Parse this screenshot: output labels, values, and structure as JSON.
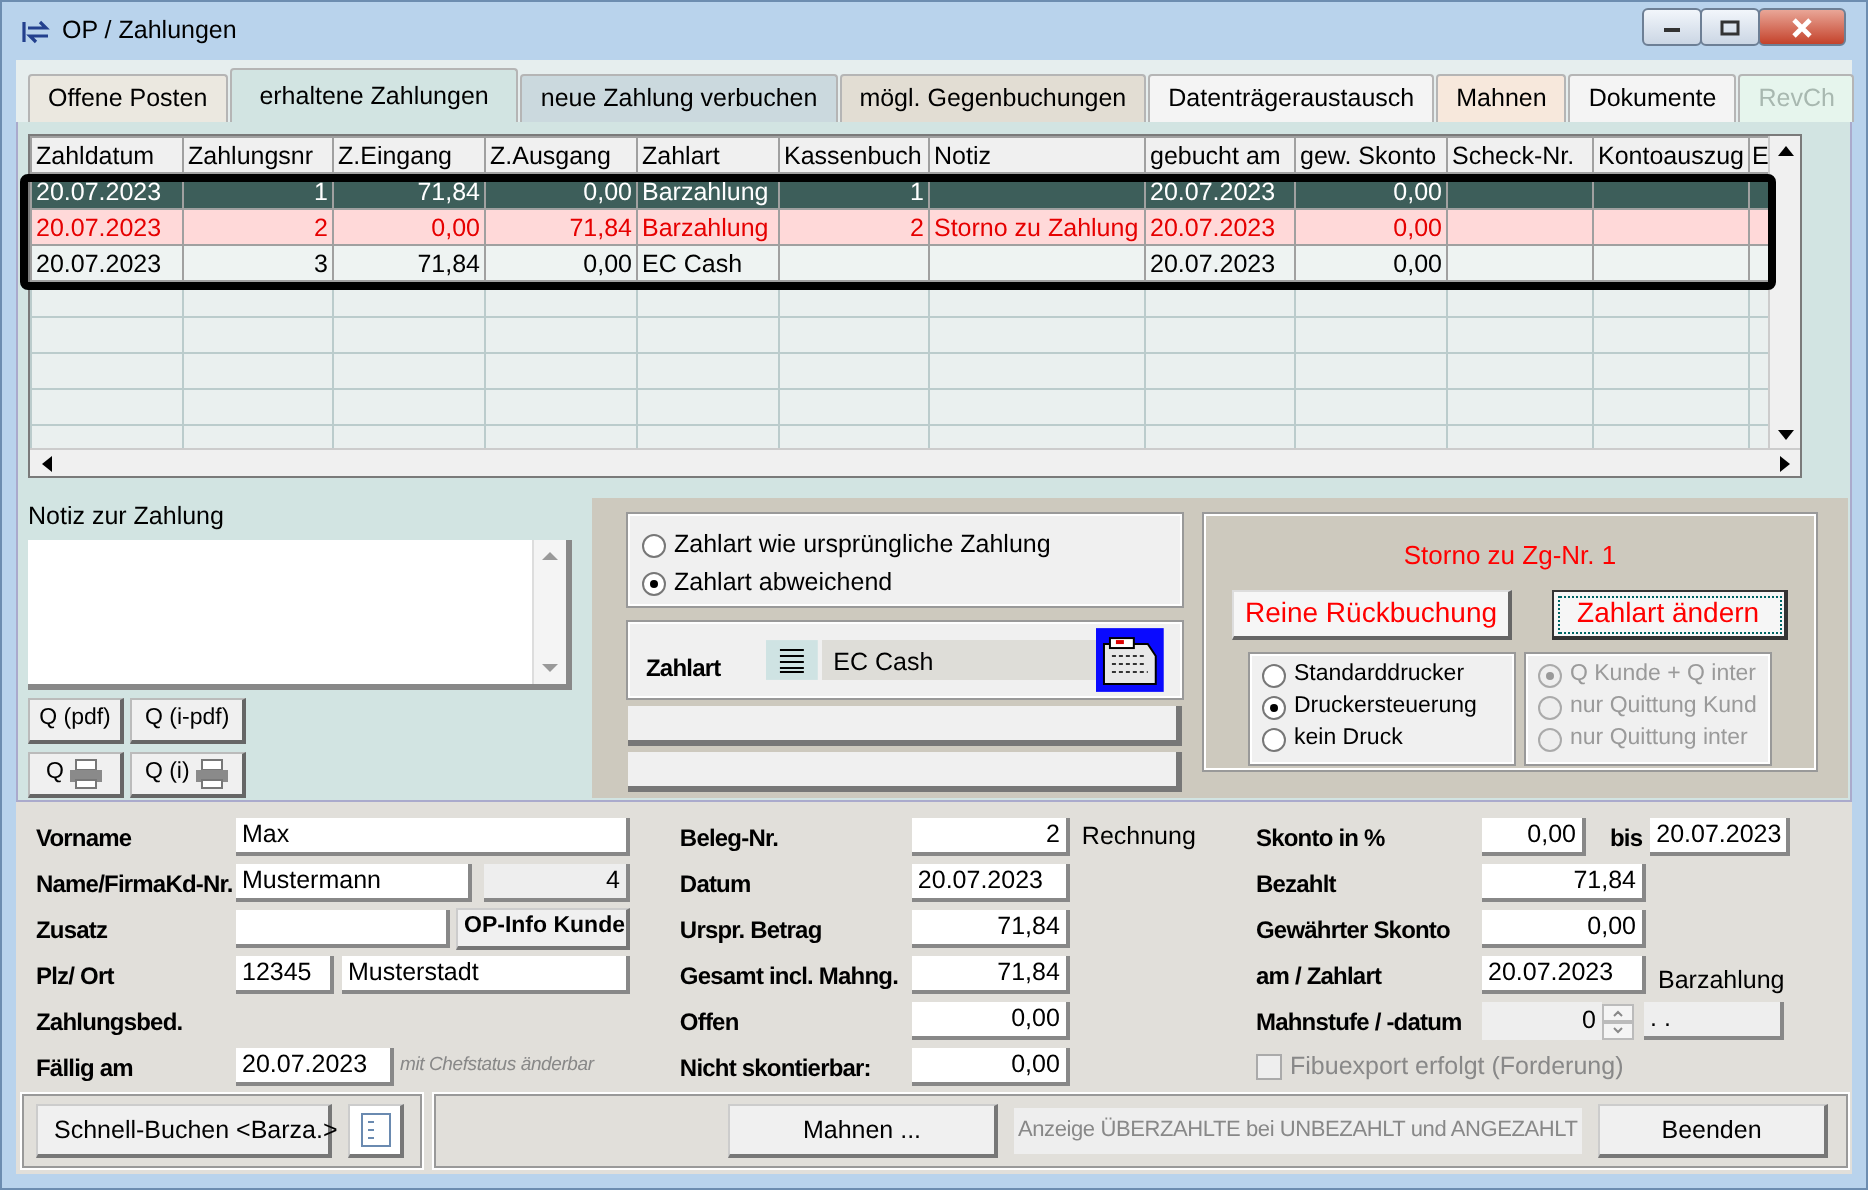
{
  "window": {
    "title": "OP / Zahlungen"
  },
  "tabs": [
    {
      "label": "Offene Posten",
      "selected": false,
      "disabled": false,
      "color": "#ebe8e0"
    },
    {
      "label": "erhaltene Zahlungen",
      "selected": true,
      "disabled": false,
      "color": "#d2e4e2"
    },
    {
      "label": "neue Zahlung verbuchen",
      "selected": false,
      "disabled": false,
      "color": "#cbd9de"
    },
    {
      "label": "mögl. Gegenbuchungen",
      "selected": false,
      "disabled": false,
      "color": "#e2ddd3"
    },
    {
      "label": "Datenträgeraustausch",
      "selected": false,
      "disabled": false,
      "color": "#f4f4f4"
    },
    {
      "label": "Mahnen",
      "selected": false,
      "disabled": false,
      "color": "#f7e8dc"
    },
    {
      "label": "Dokumente",
      "selected": false,
      "disabled": false,
      "color": "#f4f4f4"
    },
    {
      "label": "RevCh",
      "selected": false,
      "disabled": true,
      "color": "#e6f5ed"
    }
  ],
  "table": {
    "columns": [
      "Zahldatum",
      "Zahlungsnr",
      "Z.Eingang",
      "Z.Ausgang",
      "Zahlart",
      "Kassenbuch",
      "Notiz",
      "gebucht am",
      "gew. Skonto",
      "Scheck-Nr.",
      "Kontoauszug",
      "E"
    ],
    "rows": [
      {
        "selected": true,
        "kind": "payment",
        "cells": [
          "20.07.2023",
          "1",
          "71,84",
          "0,00",
          "Barzahlung",
          "1",
          "",
          "20.07.2023",
          "0,00",
          "",
          "",
          ""
        ]
      },
      {
        "selected": false,
        "kind": "reversal",
        "cells": [
          "20.07.2023",
          "2",
          "0,00",
          "71,84",
          "Barzahlung",
          "2",
          "Storno zu Zahlung",
          "20.07.2023",
          "0,00",
          "",
          "",
          ""
        ]
      },
      {
        "selected": false,
        "kind": "payment",
        "cells": [
          "20.07.2023",
          "3",
          "71,84",
          "0,00",
          "EC Cash",
          "",
          "",
          "20.07.2023",
          "0,00",
          "",
          "",
          ""
        ]
      }
    ]
  },
  "note": {
    "label": "Notiz zur Zahlung",
    "buttons": [
      {
        "label": "Q (pdf)",
        "kind": "text"
      },
      {
        "label": "Q (i-pdf)",
        "kind": "text"
      },
      {
        "label": "Q",
        "kind": "printer"
      },
      {
        "label": "Q (i)",
        "kind": "printer"
      }
    ]
  },
  "payment_type_options": [
    {
      "label": "Zahlart wie ursprüngliche Zahlung",
      "selected": false
    },
    {
      "label": "Zahlart abweichend",
      "selected": true
    }
  ],
  "payment_type": {
    "label": "Zahlart",
    "value": "EC Cash"
  },
  "reversal": {
    "title": "Storno zu Zg-Nr. 1",
    "buttons": [
      "Reine Rückbuchung",
      "Zahlart ändern"
    ],
    "printer_options": [
      {
        "label": "Standarddrucker",
        "selected": false
      },
      {
        "label": "Druckersteuerung",
        "selected": true
      },
      {
        "label": "kein Druck",
        "selected": false
      }
    ],
    "receipt_options": [
      {
        "label": "Q Kunde + Q inter",
        "selected": true,
        "disabled": true
      },
      {
        "label": "nur Quittung Kund",
        "selected": false,
        "disabled": true
      },
      {
        "label": "nur Quittung inter",
        "selected": false,
        "disabled": true
      }
    ]
  },
  "customer": {
    "first_name": {
      "label": "Vorname",
      "value": "Max"
    },
    "name": {
      "label": "Name/Firma",
      "value": "Mustermann"
    },
    "customer_no": {
      "label": "Kd-Nr.",
      "value": "4"
    },
    "addition": {
      "label": "Zusatz",
      "button": "OP-Info Kunde"
    },
    "city": {
      "label": "Plz/ Ort",
      "zip": "12345",
      "value": "Musterstadt"
    },
    "terms": {
      "label": "Zahlungsbed."
    },
    "due": {
      "label": "Fällig am",
      "value": "20.07.2023",
      "hint": "mit Chefstatus änderbar"
    }
  },
  "document": [
    {
      "label": "Beleg-Nr.",
      "value": "2",
      "suffix": "Rechnung",
      "kind": "number"
    },
    {
      "label": "Datum",
      "value": "20.07.2023",
      "kind": "date"
    },
    {
      "label": "Urspr. Betrag",
      "value": "71,84",
      "kind": "number"
    },
    {
      "label": "Gesamt incl. Mahng.",
      "value": "71,84",
      "kind": "number"
    },
    {
      "label": "Offen",
      "value": "0,00",
      "kind": "number"
    },
    {
      "label": "Nicht skontierbar:",
      "value": "0,00",
      "kind": "number"
    }
  ],
  "payment": {
    "discount": {
      "label": "Skonto in %",
      "value": "0,00",
      "until_label": "bis",
      "until": "20.07.2023"
    },
    "paid": {
      "label": "Bezahlt",
      "value": "71,84"
    },
    "granted": {
      "label": "Gewährter Skonto",
      "value": "0,00"
    },
    "date_type": {
      "label": "am / Zahlart",
      "value": "20.07.2023",
      "type": "Barzahlung"
    },
    "dunning": {
      "label": "Mahnstufe / -datum",
      "level_value": "0",
      "date": ". ."
    },
    "export": {
      "label": "Fibuexport erfolgt (Forderung)",
      "checked": false,
      "disabled": true
    }
  },
  "footer": {
    "quick_button": "Schnell-Buchen <Barza.>",
    "dunning_button": "Mahnen ...",
    "info": "Anzeige ÜBERZAHLTE bei UNBEZAHLT und ANGEZAHLT",
    "close_button": "Beenden"
  }
}
